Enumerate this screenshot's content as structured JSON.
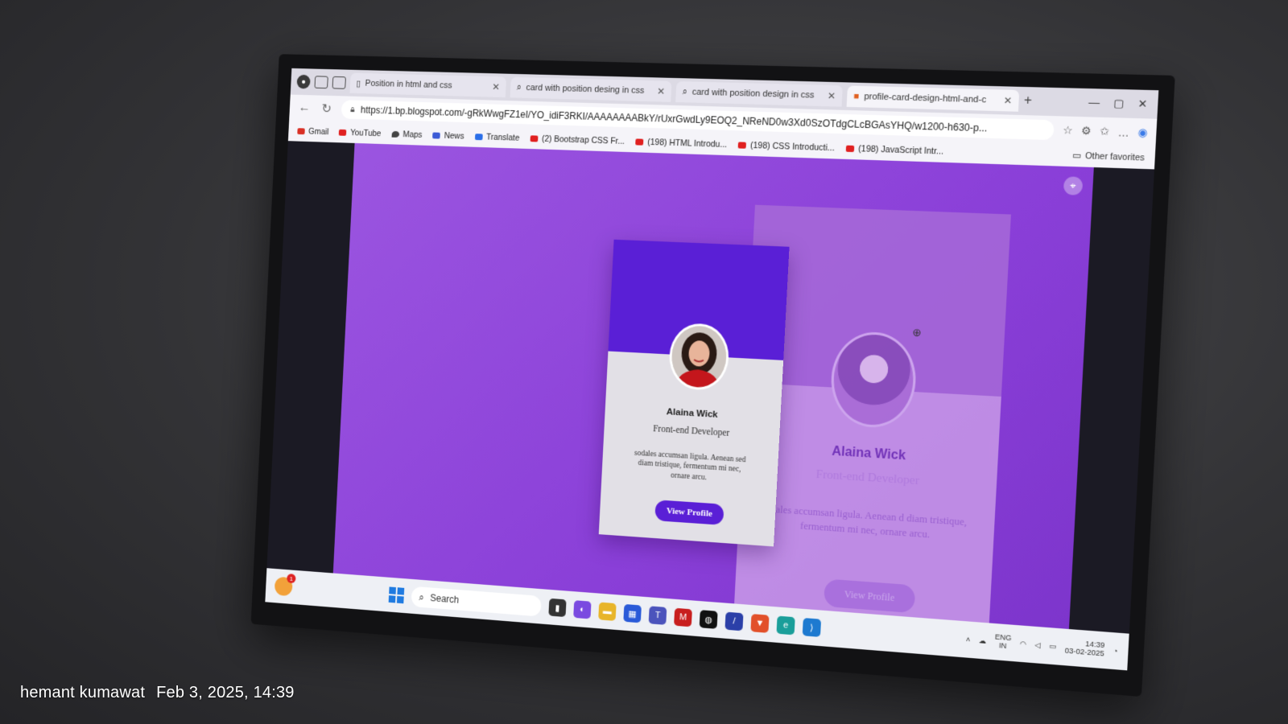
{
  "photo_caption": {
    "author": "hemant kumawat",
    "timestamp": "Feb 3, 2025, 14:39"
  },
  "browser": {
    "tabs": [
      {
        "title": "Position in html and css",
        "active": false
      },
      {
        "title": "card with position desing in css",
        "active": false
      },
      {
        "title": "card with position design in css",
        "active": false
      },
      {
        "title": "profile-card-design-html-and-c",
        "active": true
      }
    ],
    "url": "https://1.bp.blogspot.com/-gRkWwgFZ1eI/YO_idiF3RKI/AAAAAAAABkY/rUxrGwdLy9EOQ2_NReND0w3Xd0SzOTdgCLcBGAsYHQ/w1200-h630-p...",
    "bookmarks": [
      {
        "label": "Gmail",
        "icon": "gmail-icon"
      },
      {
        "label": "YouTube",
        "icon": "youtube-icon"
      },
      {
        "label": "Maps",
        "icon": "maps-icon"
      },
      {
        "label": "News",
        "icon": "news-icon"
      },
      {
        "label": "Translate",
        "icon": "translate-icon"
      },
      {
        "label": "(2) Bootstrap CSS Fr...",
        "icon": "youtube-icon"
      },
      {
        "label": "(198) HTML Introdu...",
        "icon": "youtube-icon"
      },
      {
        "label": "(198) CSS Introducti...",
        "icon": "youtube-icon"
      },
      {
        "label": "(198) JavaScript Intr...",
        "icon": "youtube-icon"
      }
    ],
    "other_favorites": "Other favorites"
  },
  "profile_card": {
    "name": "Alaina Wick",
    "role": "Front-end Developer",
    "description": "sodales accumsan ligula. Aenean sed diam tristique, fermentum mi nec, ornare arcu.",
    "button": "View Profile",
    "accent_color": "#5a1fd6"
  },
  "background_card": {
    "name": "Alaina Wick",
    "role": "Front-end Developer",
    "description": "odales accumsan ligula. Aenean d diam tristique, fermentum mi nec, ornare arcu.",
    "button": "View Profile"
  },
  "taskbar": {
    "search_placeholder": "Search",
    "notification_count": "1",
    "language": "ENG",
    "region": "IN",
    "time": "14:39",
    "date": "03-02-2025"
  },
  "colors": {
    "viewer_bg": "#8a3fd8",
    "card_header": "#5a1fd6",
    "card_body": "#e2e0e6"
  }
}
